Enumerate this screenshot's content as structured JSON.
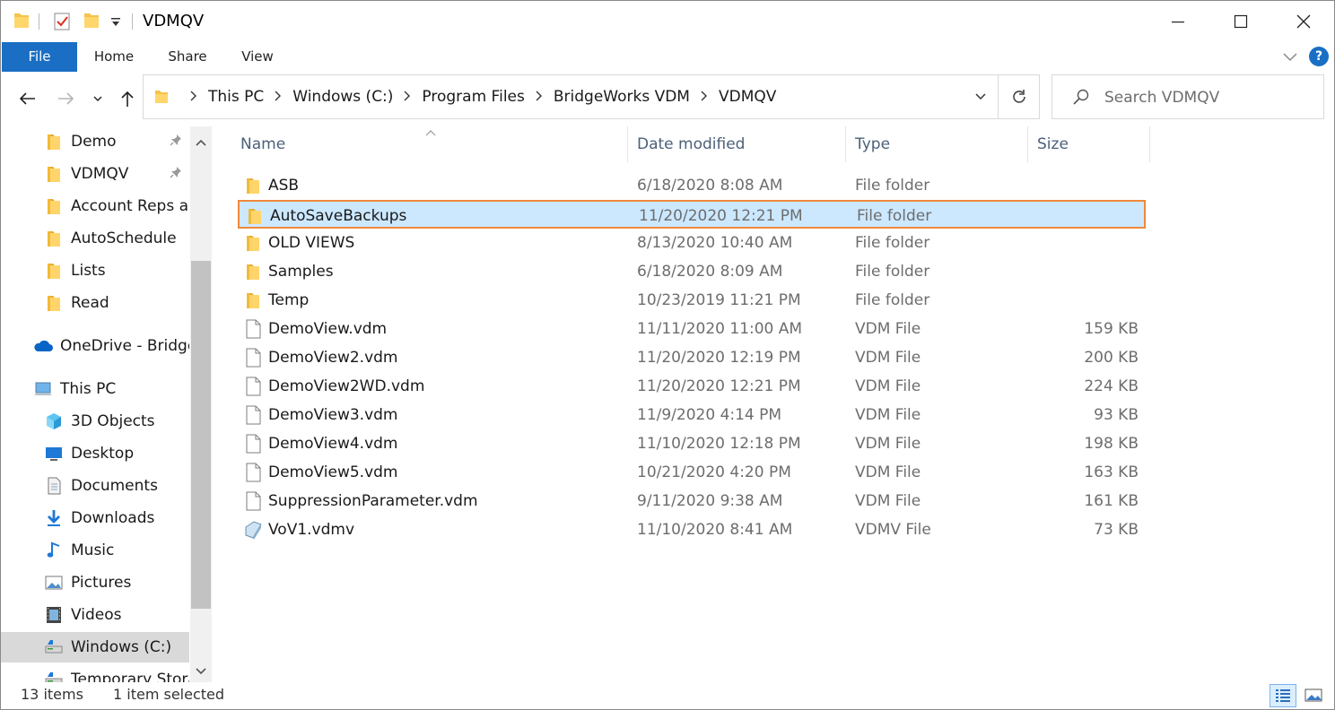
{
  "window": {
    "title": "VDMQV"
  },
  "ribbon": {
    "tabs": [
      "File",
      "Home",
      "Share",
      "View"
    ],
    "help_label": "?"
  },
  "address": {
    "crumbs": [
      "This PC",
      "Windows (C:)",
      "Program Files",
      "BridgeWorks VDM",
      "VDMQV"
    ]
  },
  "search": {
    "placeholder": "Search VDMQV"
  },
  "nav": {
    "quick_access": [
      {
        "label": "Demo",
        "pinned": true
      },
      {
        "label": "VDMQV",
        "pinned": true
      },
      {
        "label": "Account Reps an",
        "pinned": false
      },
      {
        "label": "AutoSchedule",
        "pinned": false
      },
      {
        "label": "Lists",
        "pinned": false
      },
      {
        "label": "Read",
        "pinned": false
      }
    ],
    "onedrive": "OneDrive - Bridge",
    "this_pc": "This PC",
    "pc_items": [
      "3D Objects",
      "Desktop",
      "Documents",
      "Downloads",
      "Music",
      "Pictures",
      "Videos",
      "Windows (C:)"
    ],
    "partial_item": "Temporary Stora"
  },
  "columns": {
    "name": "Name",
    "date": "Date modified",
    "type": "Type",
    "size": "Size"
  },
  "files": [
    {
      "name": "ASB",
      "date": "6/18/2020 8:08 AM",
      "type": "File folder",
      "size": "",
      "icon": "folder-icon"
    },
    {
      "name": "AutoSaveBackups",
      "date": "11/20/2020 12:21 PM",
      "type": "File folder",
      "size": "",
      "icon": "folder-icon"
    },
    {
      "name": "OLD VIEWS",
      "date": "8/13/2020 10:40 AM",
      "type": "File folder",
      "size": "",
      "icon": "folder-icon"
    },
    {
      "name": "Samples",
      "date": "6/18/2020 8:09 AM",
      "type": "File folder",
      "size": "",
      "icon": "folder-icon"
    },
    {
      "name": "Temp",
      "date": "10/23/2019 11:21 PM",
      "type": "File folder",
      "size": "",
      "icon": "folder-icon"
    },
    {
      "name": "DemoView.vdm",
      "date": "11/11/2020 11:00 AM",
      "type": "VDM File",
      "size": "159 KB",
      "icon": "file-icon"
    },
    {
      "name": "DemoView2.vdm",
      "date": "11/20/2020 12:19 PM",
      "type": "VDM File",
      "size": "200 KB",
      "icon": "file-icon"
    },
    {
      "name": "DemoView2WD.vdm",
      "date": "11/20/2020 12:21 PM",
      "type": "VDM File",
      "size": "224 KB",
      "icon": "file-icon"
    },
    {
      "name": "DemoView3.vdm",
      "date": "11/9/2020 4:14 PM",
      "type": "VDM File",
      "size": "93 KB",
      "icon": "file-icon"
    },
    {
      "name": "DemoView4.vdm",
      "date": "11/10/2020 12:18 PM",
      "type": "VDM File",
      "size": "198 KB",
      "icon": "file-icon"
    },
    {
      "name": "DemoView5.vdm",
      "date": "10/21/2020 4:20 PM",
      "type": "VDM File",
      "size": "163 KB",
      "icon": "file-icon"
    },
    {
      "name": "SuppressionParameter.vdm",
      "date": "9/11/2020 9:38 AM",
      "type": "VDM File",
      "size": "161 KB",
      "icon": "file-icon"
    },
    {
      "name": "VoV1.vdmv",
      "date": "11/10/2020 8:41 AM",
      "type": "VDMV File",
      "size": "73 KB",
      "icon": "vdmv-file-icon"
    }
  ],
  "selected_file": "AutoSaveBackups",
  "status": {
    "count": "13 items",
    "selection": "1 item selected"
  },
  "colors": {
    "accent": "#1a6fc4",
    "selection_bg": "#cce8ff",
    "highlight_border": "#f0883a",
    "folder": "#f5c34d"
  }
}
